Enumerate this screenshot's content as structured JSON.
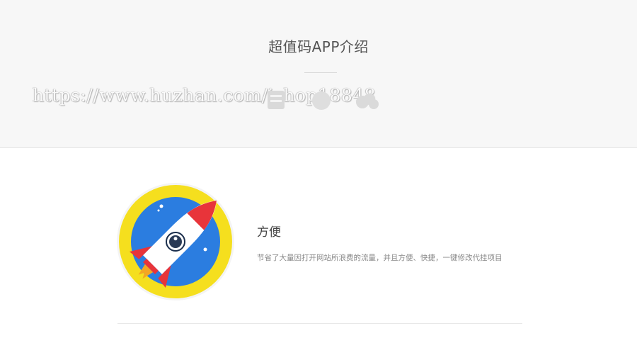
{
  "hero": {
    "title": "超值码APP介绍",
    "watermark": "https://www.huzhan.com/ishop18848"
  },
  "feature": {
    "icon": "rocket-icon",
    "title": "方便",
    "description": "节省了大量因打开网站所浪费的流量，并且方便、快捷，一键修改代挂项目"
  },
  "colors": {
    "icon_ring": "#f5df1e",
    "icon_disc": "#2b7de0",
    "rocket_body": "#ffffff",
    "rocket_fin": "#e8343a",
    "hero_bg": "#f7f7f7"
  }
}
